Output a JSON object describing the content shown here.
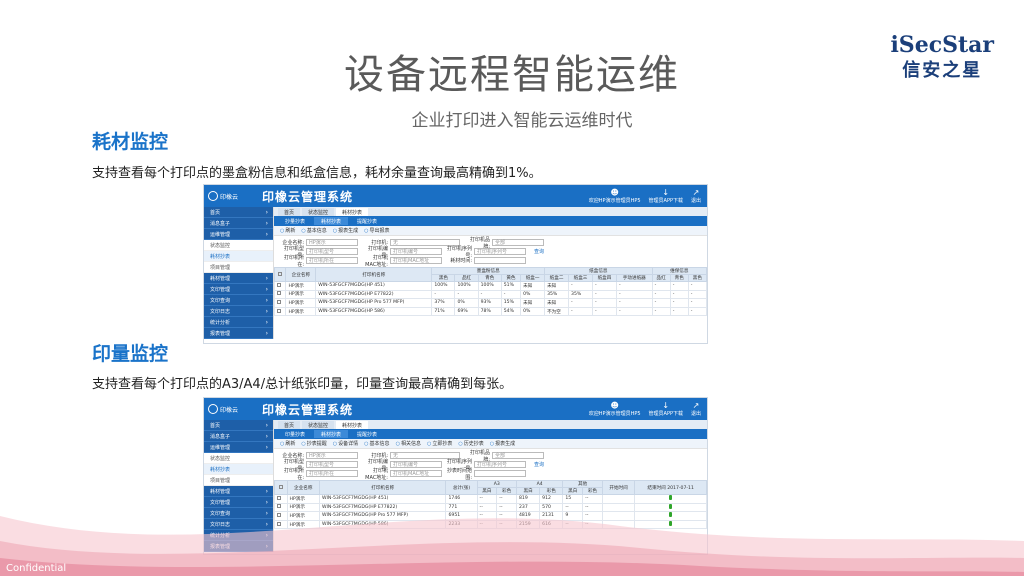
{
  "slide": {
    "title": "设备远程智能运维",
    "subtitle": "企业打印进入智能云运维时代",
    "confidential": "Confidential"
  },
  "logo": {
    "en": "iSecStar",
    "cn": "信安之星"
  },
  "sections": [
    {
      "title": "耗材监控",
      "desc": "支持查看每个打印点的墨盒粉信息和纸盒信息，耗材余量查询最高精确到1%。"
    },
    {
      "title": "印量监控",
      "desc": "支持查看每个打印点的A3/A4/总计纸张印量，印量查询最高精确到每张。"
    }
  ],
  "app1": {
    "logo_text": "印橡云",
    "title": "印橡云管理系统",
    "top_right": {
      "user": "欢迎HP演示管理员HP5",
      "download": "管理员APP下载",
      "logout": "退出"
    },
    "sidebar": [
      {
        "label": "首页",
        "type": "item"
      },
      {
        "label": "消息盒子",
        "type": "item"
      },
      {
        "label": "运维管理",
        "type": "item"
      },
      {
        "label": "状态监控",
        "type": "sub"
      },
      {
        "label": "耗材抄表",
        "type": "sub",
        "active": true
      },
      {
        "label": "项目管理",
        "type": "sub"
      },
      {
        "label": "耗材管理",
        "type": "item"
      },
      {
        "label": "文印管理",
        "type": "item"
      },
      {
        "label": "文印查询",
        "type": "item"
      },
      {
        "label": "文印日志",
        "type": "item"
      },
      {
        "label": "统计分析",
        "type": "item"
      },
      {
        "label": "报表管理",
        "type": "item"
      }
    ],
    "tabs": [
      "首页",
      "状态监控",
      "耗材抄表"
    ],
    "subtabs": [
      "抄量抄表",
      "耗材抄表",
      "提醒抄表"
    ],
    "tools": [
      "刷新",
      "基本信息",
      "报表生成",
      "导出报表"
    ],
    "form": [
      [
        {
          "label": "企业名称:",
          "value": "HP演示"
        },
        {
          "label": "打印机:",
          "value": "无"
        },
        {
          "label": "打印机品牌:",
          "value": "全部"
        }
      ],
      [
        {
          "label": "打印机型号:",
          "value": "打印机型号"
        },
        {
          "label": "打印机编号:",
          "value": "打印机编号"
        },
        {
          "label": "打印机序列号:",
          "value": "打印机序列号"
        }
      ],
      [
        {
          "label": "打印机所在:",
          "value": "打印机所在"
        },
        {
          "label": "打印机MAC地址:",
          "value": "打印机MAC地址"
        },
        {
          "label": "耗材时间:",
          "value": ""
        }
      ]
    ],
    "search": "查询",
    "group_headers": [
      "墨盒粉信息",
      "纸盒信息",
      "维保信息"
    ],
    "headers": [
      "企业名称",
      "打印机名称",
      "黑色",
      "品红",
      "青色",
      "黄色",
      "纸盒一",
      "纸盒二",
      "纸盒三",
      "纸盒四",
      "手动进纸器",
      "品红",
      "青色",
      "黑色"
    ],
    "rows": [
      [
        "HP演示",
        "WIN-53FGCF7MGDG(HP 451)",
        "100%",
        "100%",
        "100%",
        "51%",
        "未知",
        "未知",
        "-",
        "-",
        "-",
        "-",
        "-",
        "-"
      ],
      [
        "HP演示",
        "WIN-53FGCF7MGDG(HP E77822)",
        "-",
        "-",
        "-",
        "-",
        "0%",
        "35%",
        "35%",
        "-",
        "-",
        "-",
        "-",
        "-"
      ],
      [
        "HP演示",
        "WIN-53FGCF7MGDG(HP Pro 577 MFP)",
        "37%",
        "0%",
        "93%",
        "15%",
        "未知",
        "未知",
        "-",
        "-",
        "-",
        "-",
        "-",
        "-"
      ],
      [
        "HP演示",
        "WIN-53FGCF7MGDG(HP 586)",
        "71%",
        "69%",
        "78%",
        "54%",
        "0%",
        "不为空",
        "-",
        "-",
        "-",
        "-",
        "-",
        "-"
      ]
    ]
  },
  "app2": {
    "logo_text": "印橡云",
    "title": "印橡云管理系统",
    "top_right": {
      "user": "欢迎HP演示管理员HP5",
      "download": "管理员APP下载",
      "logout": "退出"
    },
    "sidebar": [
      {
        "label": "首页",
        "type": "item"
      },
      {
        "label": "消息盒子",
        "type": "item"
      },
      {
        "label": "运维管理",
        "type": "item"
      },
      {
        "label": "状态监控",
        "type": "sub"
      },
      {
        "label": "耗材抄表",
        "type": "sub",
        "active": true
      },
      {
        "label": "项目管理",
        "type": "sub"
      },
      {
        "label": "耗材管理",
        "type": "item"
      },
      {
        "label": "文印管理",
        "type": "item"
      },
      {
        "label": "文印查询",
        "type": "item"
      },
      {
        "label": "文印日志",
        "type": "item"
      },
      {
        "label": "统计分析",
        "type": "item"
      },
      {
        "label": "报表管理",
        "type": "item"
      }
    ],
    "tabs": [
      "首页",
      "状态监控",
      "耗材抄表"
    ],
    "subtabs": [
      "印量抄表",
      "耗材抄表",
      "提醒抄表"
    ],
    "tools": [
      "刷新",
      "抄表提醒",
      "设备详情",
      "基本信息",
      "相关信息",
      "立即抄表",
      "历史抄表",
      "报表生成"
    ],
    "form": [
      [
        {
          "label": "企业名称:",
          "value": "HP演示"
        },
        {
          "label": "打印机:",
          "value": "无"
        },
        {
          "label": "打印机品牌:",
          "value": "全部"
        }
      ],
      [
        {
          "label": "打印机型号:",
          "value": "打印机型号"
        },
        {
          "label": "打印机编号:",
          "value": "打印机编号"
        },
        {
          "label": "打印机序列号:",
          "value": "打印机序列号"
        }
      ],
      [
        {
          "label": "打印机所在:",
          "value": "打印机所在"
        },
        {
          "label": "打印机MAC地址:",
          "value": "打印机MAC地址"
        },
        {
          "label": "抄表时间范围:",
          "value": ""
        }
      ]
    ],
    "search": "查询",
    "group_headers": [
      "A3",
      "A4",
      "其他",
      "开始时间",
      "结束时间 2017-07-11"
    ],
    "headers": [
      "企业名称",
      "打印机名称",
      "总计(张)",
      "黑白",
      "彩色",
      "黑白",
      "彩色",
      "黑白",
      "彩色"
    ],
    "rows": [
      [
        "HP演示",
        "WIN-53FGCF7MGDG(HP 451)",
        "1746",
        "--",
        "--",
        "819",
        "912",
        "15",
        "--"
      ],
      [
        "HP演示",
        "WIN-53FGCF7MGDG(HP E77822)",
        "771",
        "--",
        "--",
        "237",
        "570",
        "--",
        "--"
      ],
      [
        "HP演示",
        "WIN-53FGCF7MGDG(HP Pro 577 MFP)",
        "6951",
        "--",
        "--",
        "4819",
        "2131",
        "9",
        "--"
      ],
      [
        "HP演示",
        "WIN-53FGCF7MGDG(HP 586)",
        "2233",
        "--",
        "--",
        "2159",
        "616",
        "--",
        "--"
      ]
    ]
  }
}
